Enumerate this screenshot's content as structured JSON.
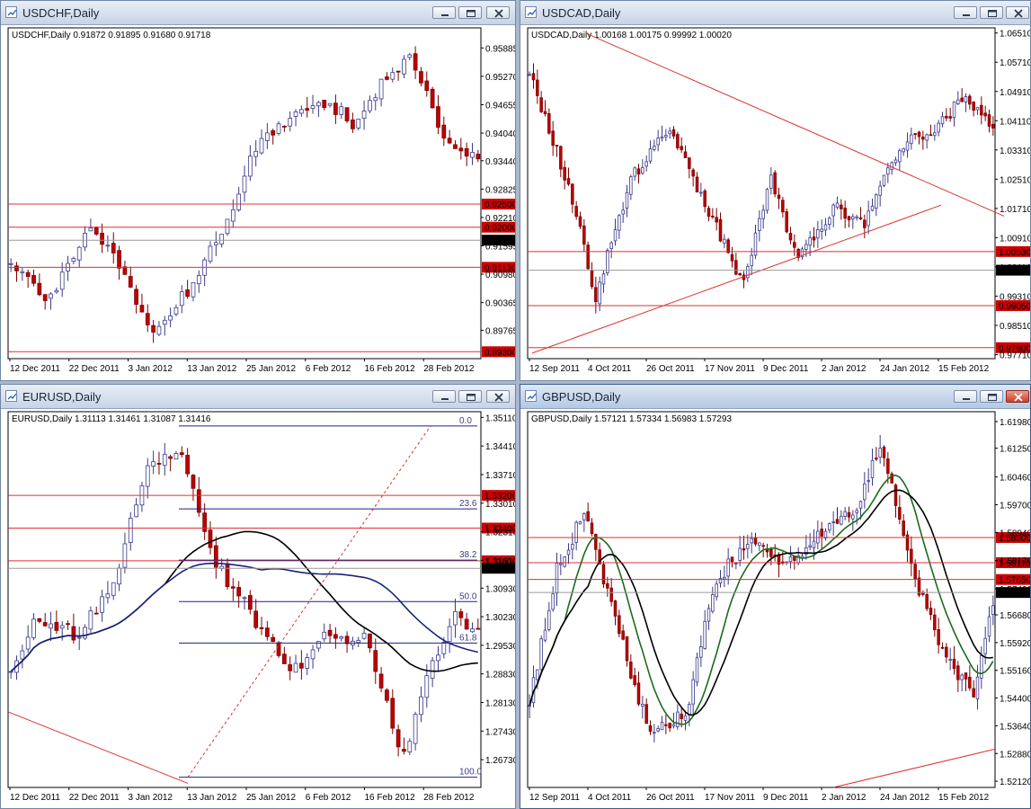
{
  "app": {
    "name": "MetaTrader 4"
  },
  "colors": {
    "background": "#aab8cc",
    "bull": "#ffffff",
    "bull_outline": "#3a3a8c",
    "bear": "#c00000",
    "level_line": "#dd3030",
    "trend_line": "#dd3030",
    "fib_line": "#1a237e",
    "ma_blue": "#1a237e",
    "ma_black": "#000000",
    "ma_green": "#1b6b1b",
    "price_label_bg": "#cc0000",
    "current_label_bg": "#000000"
  },
  "windows": [
    {
      "title": "USDCHF,Daily",
      "header_text": "USDCHF,Daily  0.91872 0.91895 0.91680 0.91718",
      "price_min": 0.8915,
      "price_max": 0.9632,
      "price_ticks": [
        "0.95885",
        "0.95270",
        "0.94655",
        "0.94040",
        "0.93440",
        "0.92825",
        "0.92210",
        "0.91595",
        "0.90980",
        "0.90365",
        "0.89765",
        "0.89150"
      ],
      "time_ticks": [
        "12 Dec 2011",
        "22 Dec 2011",
        "3 Jan 2012",
        "13 Jan 2012",
        "25 Jan 2012",
        "6 Feb 2012",
        "16 Feb 2012",
        "28 Feb 2012"
      ],
      "levels": [
        "0.92500",
        "0.92000",
        "0.91130",
        "0.89300"
      ],
      "current_price": "0.91718",
      "trend_from": 0.9175,
      "trend_to": 0.893
    },
    {
      "title": "USDCAD,Daily",
      "header_text": "USDCAD,Daily  1.00168 1.00175 0.99992 1.00020",
      "price_min": 0.976,
      "price_max": 1.0665,
      "price_ticks": [
        "1.06510",
        "1.05710",
        "1.04910",
        "1.04110",
        "1.03310",
        "1.02510",
        "1.01710",
        "1.00910",
        "1.00110",
        "0.99310",
        "0.98510",
        "0.97710"
      ],
      "time_ticks": [
        "12 Sep 2011",
        "4 Oct 2011",
        "26 Oct 2011",
        "17 Nov 2011",
        "9 Dec 2011",
        "2 Jan 2012",
        "24 Jan 2012",
        "15 Feb 2012"
      ],
      "levels": [
        "1.00530",
        "0.99050",
        "0.97900"
      ],
      "current_price": "1.00020",
      "trend_from": 0.978,
      "trend_to": 1.0002
    },
    {
      "title": "EURUSD,Daily",
      "header_text": "EURUSD,Daily  1.31113 1.31461 1.31087 1.31416",
      "price_min": 1.2605,
      "price_max": 1.3525,
      "price_ticks": [
        "1.35110",
        "1.34410",
        "1.33710",
        "1.33010",
        "1.32310",
        "1.31610",
        "1.30930",
        "1.30230",
        "1.29530",
        "1.28830",
        "1.28130",
        "1.27430",
        "1.26730",
        "1.26050"
      ],
      "time_ticks": [
        "12 Dec 2011",
        "22 Dec 2011",
        "3 Jan 2012",
        "13 Jan 2012",
        "25 Jan 2012",
        "6 Feb 2012",
        "16 Feb 2012",
        "28 Feb 2012"
      ],
      "levels": [
        "1.33200",
        "1.32400",
        "1.31600"
      ],
      "current_price": "1.31416",
      "fib_levels": [
        "0.0",
        "23.6",
        "38.2",
        "50.0",
        "61.8",
        "100.0"
      ],
      "trend_from": 1.3,
      "trend_to": 1.3142
    },
    {
      "title": "GBPUSD,Daily",
      "header_text": "GBPUSD,Daily  1.57121 1.57334 1.56983 1.57293",
      "price_min": 1.5195,
      "price_max": 1.6225,
      "price_ticks": [
        "1.61980",
        "1.61250",
        "1.60460",
        "1.59700",
        "1.58940",
        "1.58170",
        "1.57400",
        "1.56680",
        "1.55920",
        "1.55160",
        "1.54400",
        "1.53640",
        "1.52880",
        "1.52120"
      ],
      "time_ticks": [
        "12 Sep 2011",
        "4 Oct 2011",
        "26 Oct 2011",
        "17 Nov 2011",
        "9 Dec 2011",
        "2 Jan 2012",
        "24 Jan 2012",
        "15 Feb 2012"
      ],
      "levels": [
        "1.58800",
        "1.58110",
        "1.57650"
      ],
      "current_price": "1.57293",
      "trend_from": 1.62,
      "trend_to": 1.573
    }
  ]
}
